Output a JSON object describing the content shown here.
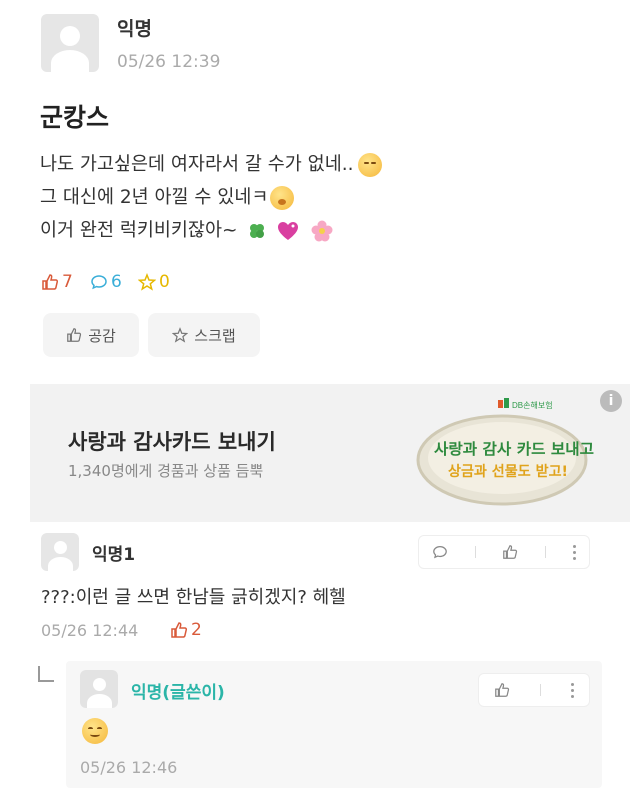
{
  "post": {
    "author": "익명",
    "timestamp": "05/26 12:39",
    "title": "군캉스",
    "lines": [
      "나도 가고싶은데 여자라서 갈 수가 없네..",
      "그 대신에 2년 아낄 수 있네ㅋ",
      "이거 완전 럭키비키잖아~"
    ],
    "likes": "7",
    "comments": "6",
    "scraps": "0",
    "like_button": "공감",
    "scrap_button": "스크랩",
    "colors": {
      "like": "#d95a3a",
      "comment": "#3aaed8",
      "scrap": "#e6b800"
    }
  },
  "ad": {
    "title": "사랑과 감사카드 보내기",
    "subtitle": "1,340명에게 경품과 상품 듬뿍",
    "info_icon": "i",
    "brand": "DB손해보험",
    "card_line1": "사랑과 감사 카드 보내고",
    "card_line2": "상금과 선물도 받고!"
  },
  "comment": {
    "author": "익명1",
    "text": "???:이런 글 쓰면 한남들 긁히겠지? 헤헬",
    "timestamp": "05/26 12:44",
    "likes": "2"
  },
  "reply": {
    "author": "익명(글쓴이)",
    "timestamp": "05/26 12:46",
    "author_color": "#2bb5a8"
  }
}
